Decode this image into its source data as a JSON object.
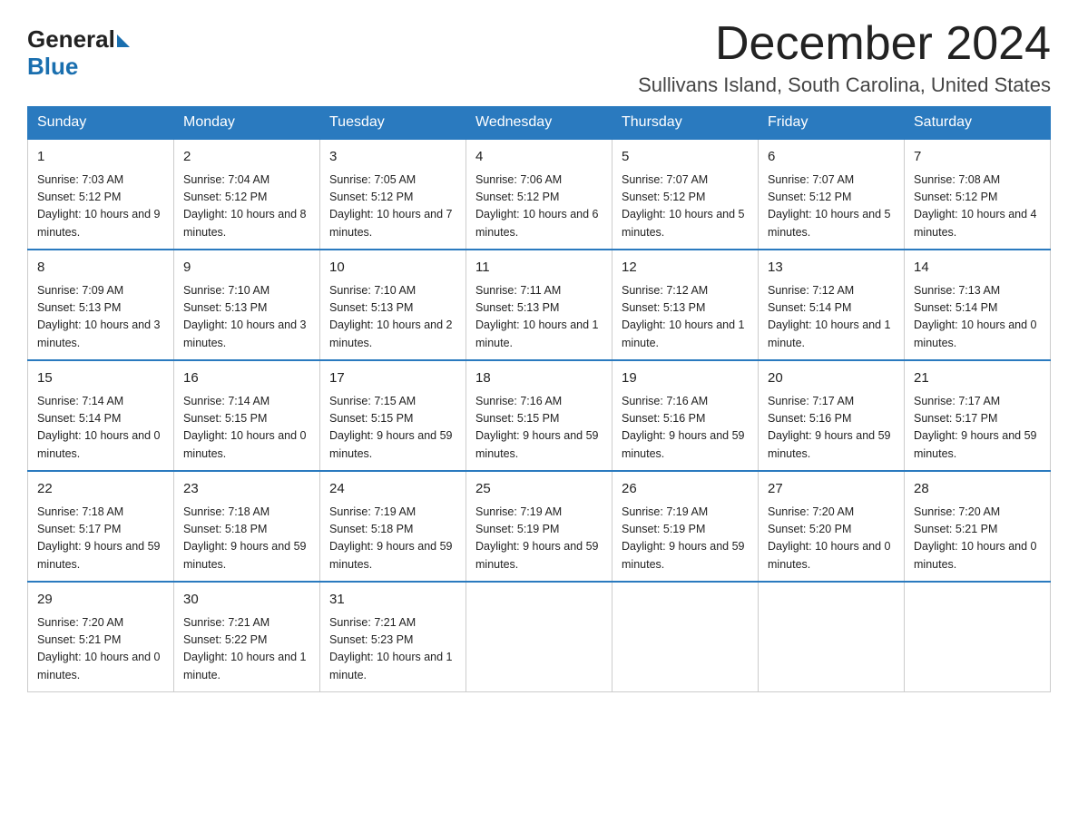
{
  "logo": {
    "general": "General",
    "blue": "Blue"
  },
  "header": {
    "month": "December 2024",
    "location": "Sullivans Island, South Carolina, United States"
  },
  "weekdays": [
    "Sunday",
    "Monday",
    "Tuesday",
    "Wednesday",
    "Thursday",
    "Friday",
    "Saturday"
  ],
  "weeks": [
    [
      {
        "day": "1",
        "sunrise": "7:03 AM",
        "sunset": "5:12 PM",
        "daylight": "10 hours and 9 minutes."
      },
      {
        "day": "2",
        "sunrise": "7:04 AM",
        "sunset": "5:12 PM",
        "daylight": "10 hours and 8 minutes."
      },
      {
        "day": "3",
        "sunrise": "7:05 AM",
        "sunset": "5:12 PM",
        "daylight": "10 hours and 7 minutes."
      },
      {
        "day": "4",
        "sunrise": "7:06 AM",
        "sunset": "5:12 PM",
        "daylight": "10 hours and 6 minutes."
      },
      {
        "day": "5",
        "sunrise": "7:07 AM",
        "sunset": "5:12 PM",
        "daylight": "10 hours and 5 minutes."
      },
      {
        "day": "6",
        "sunrise": "7:07 AM",
        "sunset": "5:12 PM",
        "daylight": "10 hours and 5 minutes."
      },
      {
        "day": "7",
        "sunrise": "7:08 AM",
        "sunset": "5:12 PM",
        "daylight": "10 hours and 4 minutes."
      }
    ],
    [
      {
        "day": "8",
        "sunrise": "7:09 AM",
        "sunset": "5:13 PM",
        "daylight": "10 hours and 3 minutes."
      },
      {
        "day": "9",
        "sunrise": "7:10 AM",
        "sunset": "5:13 PM",
        "daylight": "10 hours and 3 minutes."
      },
      {
        "day": "10",
        "sunrise": "7:10 AM",
        "sunset": "5:13 PM",
        "daylight": "10 hours and 2 minutes."
      },
      {
        "day": "11",
        "sunrise": "7:11 AM",
        "sunset": "5:13 PM",
        "daylight": "10 hours and 1 minute."
      },
      {
        "day": "12",
        "sunrise": "7:12 AM",
        "sunset": "5:13 PM",
        "daylight": "10 hours and 1 minute."
      },
      {
        "day": "13",
        "sunrise": "7:12 AM",
        "sunset": "5:14 PM",
        "daylight": "10 hours and 1 minute."
      },
      {
        "day": "14",
        "sunrise": "7:13 AM",
        "sunset": "5:14 PM",
        "daylight": "10 hours and 0 minutes."
      }
    ],
    [
      {
        "day": "15",
        "sunrise": "7:14 AM",
        "sunset": "5:14 PM",
        "daylight": "10 hours and 0 minutes."
      },
      {
        "day": "16",
        "sunrise": "7:14 AM",
        "sunset": "5:15 PM",
        "daylight": "10 hours and 0 minutes."
      },
      {
        "day": "17",
        "sunrise": "7:15 AM",
        "sunset": "5:15 PM",
        "daylight": "9 hours and 59 minutes."
      },
      {
        "day": "18",
        "sunrise": "7:16 AM",
        "sunset": "5:15 PM",
        "daylight": "9 hours and 59 minutes."
      },
      {
        "day": "19",
        "sunrise": "7:16 AM",
        "sunset": "5:16 PM",
        "daylight": "9 hours and 59 minutes."
      },
      {
        "day": "20",
        "sunrise": "7:17 AM",
        "sunset": "5:16 PM",
        "daylight": "9 hours and 59 minutes."
      },
      {
        "day": "21",
        "sunrise": "7:17 AM",
        "sunset": "5:17 PM",
        "daylight": "9 hours and 59 minutes."
      }
    ],
    [
      {
        "day": "22",
        "sunrise": "7:18 AM",
        "sunset": "5:17 PM",
        "daylight": "9 hours and 59 minutes."
      },
      {
        "day": "23",
        "sunrise": "7:18 AM",
        "sunset": "5:18 PM",
        "daylight": "9 hours and 59 minutes."
      },
      {
        "day": "24",
        "sunrise": "7:19 AM",
        "sunset": "5:18 PM",
        "daylight": "9 hours and 59 minutes."
      },
      {
        "day": "25",
        "sunrise": "7:19 AM",
        "sunset": "5:19 PM",
        "daylight": "9 hours and 59 minutes."
      },
      {
        "day": "26",
        "sunrise": "7:19 AM",
        "sunset": "5:19 PM",
        "daylight": "9 hours and 59 minutes."
      },
      {
        "day": "27",
        "sunrise": "7:20 AM",
        "sunset": "5:20 PM",
        "daylight": "10 hours and 0 minutes."
      },
      {
        "day": "28",
        "sunrise": "7:20 AM",
        "sunset": "5:21 PM",
        "daylight": "10 hours and 0 minutes."
      }
    ],
    [
      {
        "day": "29",
        "sunrise": "7:20 AM",
        "sunset": "5:21 PM",
        "daylight": "10 hours and 0 minutes."
      },
      {
        "day": "30",
        "sunrise": "7:21 AM",
        "sunset": "5:22 PM",
        "daylight": "10 hours and 1 minute."
      },
      {
        "day": "31",
        "sunrise": "7:21 AM",
        "sunset": "5:23 PM",
        "daylight": "10 hours and 1 minute."
      },
      null,
      null,
      null,
      null
    ]
  ]
}
